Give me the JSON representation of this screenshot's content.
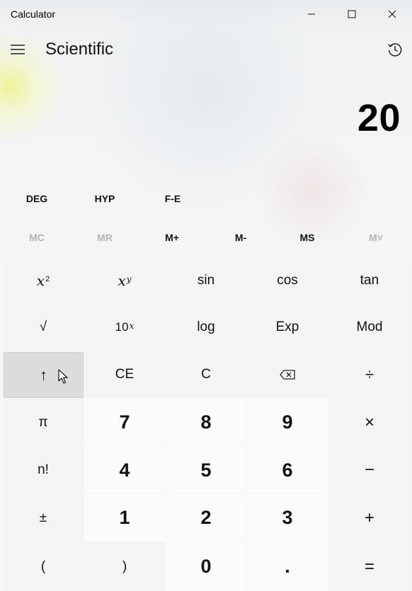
{
  "window": {
    "title": "Calculator"
  },
  "icons": {
    "minimize": "minimize-icon",
    "maximize": "maximize-icon",
    "close": "close-icon",
    "menu": "hamburger-icon",
    "history": "history-icon",
    "backspace": "backspace-icon"
  },
  "header": {
    "mode": "Scientific"
  },
  "display": {
    "value": "20"
  },
  "toggles": {
    "deg": "DEG",
    "hyp": "HYP",
    "fe": "F-E"
  },
  "memory": {
    "mc": "MC",
    "mr": "MR",
    "mplus": "M+",
    "mminus": "M-",
    "ms": "MS",
    "mlist": "M˅"
  },
  "keys": {
    "x": "x",
    "two": "2",
    "y": "y",
    "ten": "10",
    "sin": "sin",
    "cos": "cos",
    "tan": "tan",
    "sqrt": "√",
    "log": "log",
    "exp": "Exp",
    "mod": "Mod",
    "shift": "↑",
    "ce": "CE",
    "c": "C",
    "divide": "÷",
    "pi": "π",
    "fact": "n!",
    "multiply": "×",
    "minus": "−",
    "plus": "+",
    "plusminus": "±",
    "lparen": "(",
    "rparen": ")",
    "dot": ".",
    "equals": "=",
    "n7": "7",
    "n8": "8",
    "n9": "9",
    "n4": "4",
    "n5": "5",
    "n6": "6",
    "n1": "1",
    "n2": "2",
    "n3": "3",
    "n0": "0"
  }
}
